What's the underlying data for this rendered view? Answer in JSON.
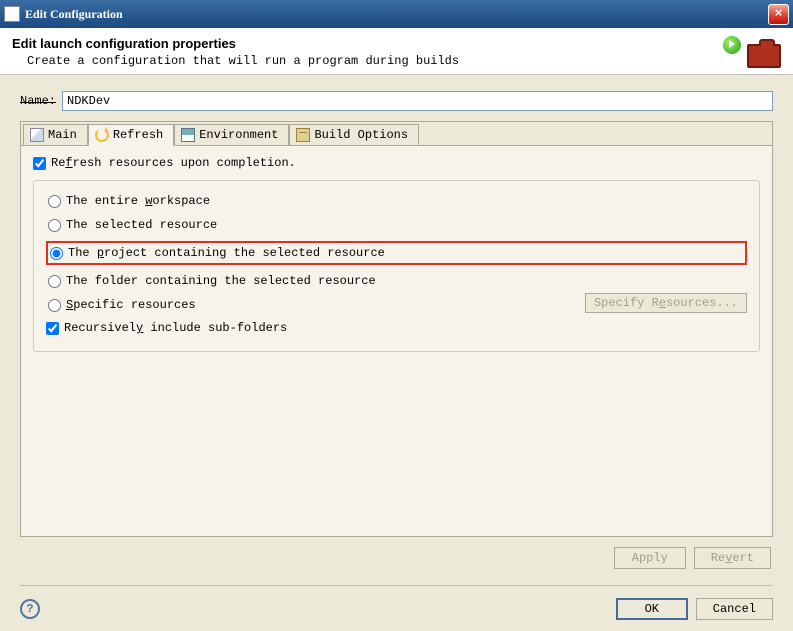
{
  "window": {
    "title": "Edit Configuration"
  },
  "header": {
    "title": "Edit launch configuration properties",
    "subtitle": "Create a configuration that will run a program during builds"
  },
  "name": {
    "label": "Name:",
    "value": "NDKDev"
  },
  "tabs": {
    "main": "Main",
    "refresh": "Refresh",
    "environment": "Environment",
    "build_options": "Build Options",
    "active": "refresh"
  },
  "refresh_panel": {
    "refresh_on_completion": {
      "label": "Refresh resources upon completion.",
      "checked": true
    },
    "scope": {
      "entire_workspace": "The entire workspace",
      "selected_resource": "The selected resource",
      "project_containing": "The project containing the selected resource",
      "folder_containing": "The folder containing the selected resource",
      "specific_resources": "Specific resources",
      "selected": "project_containing"
    },
    "specify_button": "Specify Resources...",
    "recursive": {
      "label": "Recursively include sub-folders",
      "checked": true
    }
  },
  "buttons": {
    "apply": "Apply",
    "revert": "Revert",
    "ok": "OK",
    "cancel": "Cancel"
  }
}
